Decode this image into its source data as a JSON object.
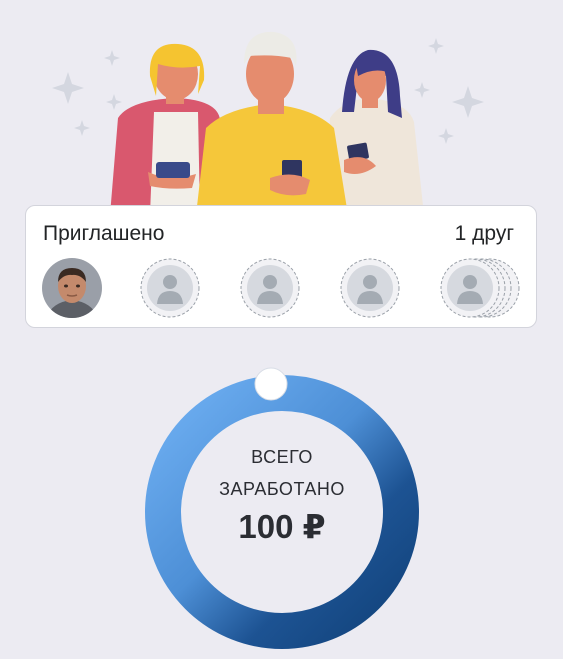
{
  "invited": {
    "title": "Приглашено",
    "count_label": "1 друг",
    "friends": [
      {
        "state": "joined",
        "icon": "friend-photo"
      },
      {
        "state": "empty",
        "icon": "person-placeholder-icon"
      },
      {
        "state": "empty",
        "icon": "person-placeholder-icon"
      },
      {
        "state": "empty",
        "icon": "person-placeholder-icon"
      },
      {
        "state": "empty-stack",
        "icon": "person-placeholder-icon"
      }
    ]
  },
  "earnings": {
    "label_line1": "ВСЕГО",
    "label_line2": "ЗАРАБОТАНО",
    "amount": "100 ₽"
  },
  "colors": {
    "background": "#ecebf2",
    "ring_light": "#6fb0f3",
    "ring_dark": "#11427a",
    "placeholder": "#a4abb3"
  }
}
